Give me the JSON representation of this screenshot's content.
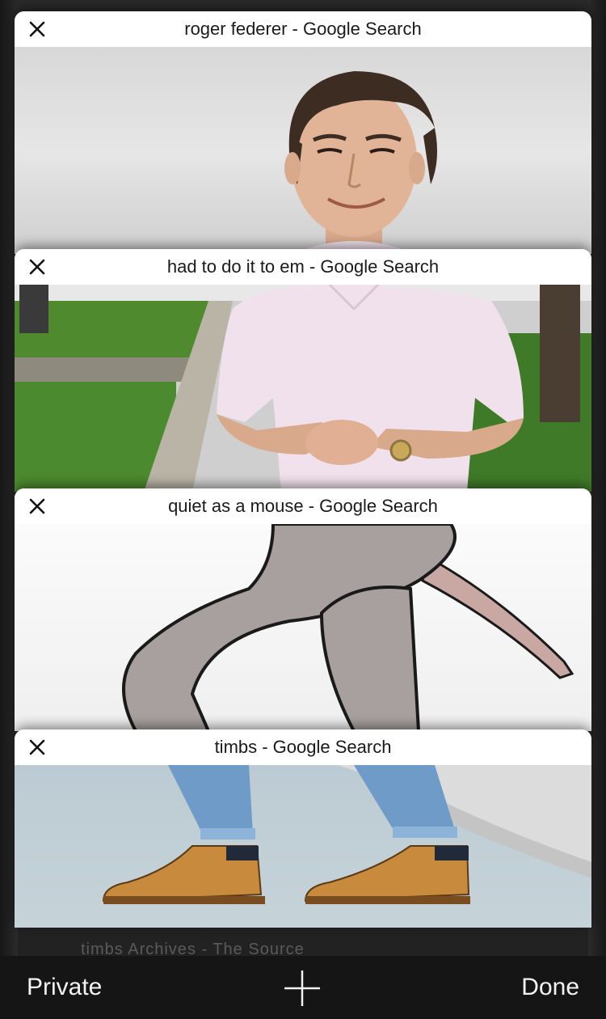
{
  "tabs": [
    {
      "title": "roger federer - Google Search",
      "close_icon": "close-icon"
    },
    {
      "title": "had to do it to em - Google Search",
      "close_icon": "close-icon"
    },
    {
      "title": "quiet as a mouse - Google Search",
      "close_icon": "close-icon"
    },
    {
      "title": "timbs - Google Search",
      "close_icon": "close-icon"
    }
  ],
  "background_partial_text": "timbs Archives - The Source",
  "toolbar": {
    "private_label": "Private",
    "new_tab_icon": "plus-icon",
    "done_label": "Done"
  },
  "colors": {
    "toolbar_bg": "#151515",
    "card_header_bg": "#ffffff",
    "text_light": "#f2f2f2"
  }
}
